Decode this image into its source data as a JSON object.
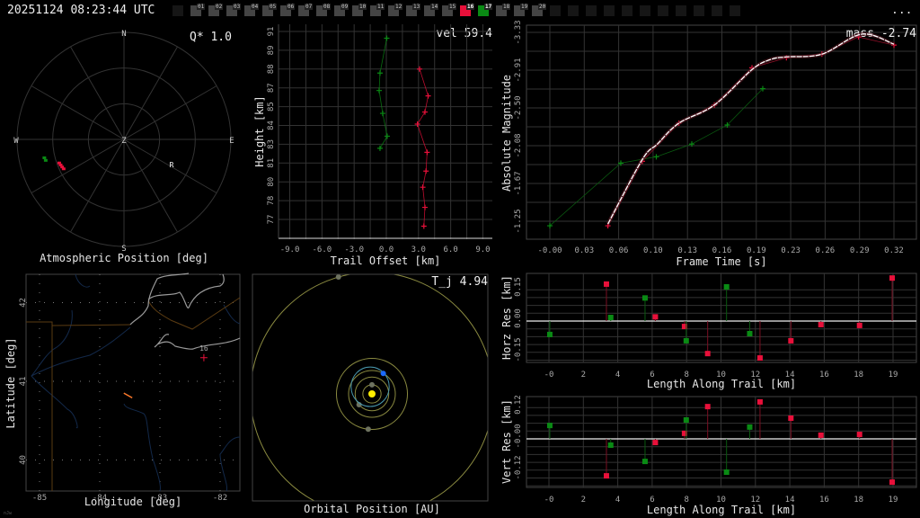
{
  "header": {
    "timestamp": "20251124 08:23:44 UTC",
    "menu_label": "...",
    "frames": [
      "01",
      "02",
      "03",
      "04",
      "05",
      "06",
      "07",
      "08",
      "09",
      "10",
      "11",
      "12",
      "13",
      "14",
      "15",
      "16",
      "17",
      "18",
      "19",
      "20"
    ],
    "selected_red": "16",
    "selected_green": "17",
    "blank_before": 1,
    "blank_after": 11
  },
  "colors": {
    "station_a": "#e8103a",
    "station_b": "#0a8a14",
    "fit": "#ffffff",
    "grid": "#333333",
    "background": "#000000"
  },
  "chart_data": [
    {
      "id": "atmospheric",
      "type": "scatter",
      "title": "Atmospheric Position [deg]",
      "annotation": "Q*  1.0",
      "compass": {
        "n": "N",
        "s": "S",
        "e": "E",
        "w": "W",
        "zenith": "Z"
      },
      "rings_alt_deg": [
        60,
        30,
        0
      ],
      "series": [
        {
          "name": "station-16",
          "color": "#e8103a",
          "points": [
            {
              "az": 244,
              "alt": 33.5
            },
            {
              "az": 246,
              "alt": 33
            },
            {
              "az": 248,
              "alt": 32.5
            },
            {
              "az": 250,
              "alt": 32
            }
          ]
        },
        {
          "name": "station-17",
          "color": "#0a8a14",
          "points": [
            {
              "az": 255,
              "alt": 21.8
            },
            {
              "az": 257,
              "alt": 21.2
            }
          ]
        }
      ],
      "radiant": {
        "label": "R",
        "az": 118,
        "alt": 44.6
      }
    },
    {
      "id": "trail",
      "type": "line",
      "xlabel": "Trail Offset [km]",
      "ylabel": "Height [km]",
      "annotation": "vel 59.4",
      "xticks": [
        "-9.0",
        "-6.0",
        "-3.0",
        "0.0",
        "3.0",
        "6.0",
        "9.0"
      ],
      "yticks": [
        "91",
        "89",
        "88",
        "87",
        "85",
        "84",
        "83",
        "81",
        "80",
        "78",
        "77"
      ],
      "xlim": [
        -9.9,
        10.0
      ],
      "ylim": [
        76.0,
        91.5
      ],
      "series": [
        {
          "name": "station-17",
          "color": "#0a8a14",
          "x": [
            0.04,
            -0.59,
            -0.67,
            -0.34,
            0.08,
            -0.59
          ],
          "y": [
            90.5,
            87.9,
            86.6,
            84.9,
            83.2,
            82.3
          ]
        },
        {
          "name": "station-16",
          "color": "#e8103a",
          "x": [
            3.1,
            3.9,
            3.6,
            2.9,
            3.8,
            3.7,
            3.4,
            3.6,
            3.5
          ],
          "y": [
            88.2,
            86.2,
            85.0,
            84.1,
            82.0,
            80.6,
            79.4,
            77.9,
            76.5
          ]
        }
      ]
    },
    {
      "id": "magnitude",
      "type": "line",
      "xlabel": "Frame Time [s]",
      "ylabel": "Absolute Magnitude",
      "annotation": "mass -2.74",
      "xticks": [
        "-0.00",
        "0.03",
        "0.06",
        "0.10",
        "0.13",
        "0.16",
        "0.19",
        "0.23",
        "0.26",
        "0.29",
        "0.32"
      ],
      "yticks": [
        "-3.33",
        "-2.91",
        "-2.50",
        "-2.08",
        "-1.67",
        "-1.25"
      ],
      "series": [
        {
          "name": "station-17",
          "color": "#0a8a14",
          "x": [
            0.0,
            0.066,
            0.099,
            0.132,
            0.165,
            0.198
          ],
          "y": [
            -1.2,
            -1.89,
            -1.96,
            -2.1,
            -2.31,
            -2.71
          ]
        },
        {
          "name": "station-16",
          "color": "#e8103a",
          "x": [
            0.054,
            0.086,
            0.12,
            0.153,
            0.188,
            0.22,
            0.253,
            0.287,
            0.32
          ],
          "y": [
            -1.2,
            -1.91,
            -2.33,
            -2.53,
            -2.94,
            -3.05,
            -3.09,
            -3.28,
            -3.19
          ]
        },
        {
          "name": "fit",
          "color": "#ffffff",
          "x": [
            0.054,
            0.086,
            0.1,
            0.12,
            0.153,
            0.188,
            0.205,
            0.22,
            0.253,
            0.29,
            0.32
          ],
          "y": [
            -1.22,
            -1.93,
            -2.1,
            -2.33,
            -2.53,
            -2.92,
            -3.03,
            -3.06,
            -3.09,
            -3.31,
            -3.2
          ]
        }
      ]
    },
    {
      "id": "horz-res",
      "type": "scatter",
      "xlabel": "Length Along Trail [km]",
      "ylabel": "Horz Res [km]",
      "xticks": [
        "-0",
        "2",
        "4",
        "6",
        "8",
        "10",
        "12",
        "14",
        "16",
        "18",
        "19"
      ],
      "yticks": [
        "0.15",
        "0.00",
        "-0.15"
      ],
      "series": [
        {
          "name": "station-16",
          "color": "#e8103a",
          "x": [
            3.35,
            6.2,
            7.9,
            9.25,
            12.3,
            14.1,
            15.85,
            18.1,
            20.0
          ],
          "y": [
            0.176,
            0.02,
            -0.026,
            -0.155,
            -0.176,
            -0.094,
            -0.017,
            -0.021,
            0.205
          ]
        },
        {
          "name": "station-17",
          "color": "#0a8a14",
          "x": [
            0.05,
            3.6,
            5.6,
            8.0,
            10.35,
            11.7
          ],
          "y": [
            -0.064,
            0.017,
            0.11,
            -0.094,
            0.163,
            -0.06
          ]
        }
      ]
    },
    {
      "id": "vert-res",
      "type": "scatter",
      "xlabel": "Length Along Trail [km]",
      "ylabel": "Vert Res [km]",
      "xticks": [
        "-0",
        "2",
        "4",
        "6",
        "8",
        "10",
        "12",
        "14",
        "16",
        "18",
        "19"
      ],
      "yticks": [
        "0.12",
        "-0.00",
        "-0.12"
      ],
      "series": [
        {
          "name": "station-16",
          "color": "#e8103a",
          "x": [
            3.35,
            6.2,
            7.9,
            9.25,
            12.3,
            14.1,
            15.85,
            18.1,
            20.0
          ],
          "y": [
            -0.141,
            -0.014,
            0.021,
            0.123,
            0.141,
            0.079,
            0.014,
            0.017,
            -0.165
          ]
        },
        {
          "name": "station-17",
          "color": "#0a8a14",
          "x": [
            0.05,
            3.6,
            5.6,
            8.0,
            10.35,
            11.7
          ],
          "y": [
            0.051,
            -0.024,
            -0.086,
            0.072,
            -0.127,
            0.045
          ]
        }
      ]
    },
    {
      "id": "map",
      "type": "scatter",
      "xlabel": "Longitude [deg]",
      "ylabel": "Latitude [deg]",
      "xticks": [
        "-85",
        "-84",
        "-83",
        "-82"
      ],
      "yticks": [
        "42",
        "41",
        "40"
      ],
      "station": {
        "label": "16",
        "lon": -82.27,
        "lat": 41.3
      },
      "track": {
        "lon": [
          -83.6,
          -83.46
        ],
        "lat": [
          40.85,
          40.79
        ]
      },
      "credit": "nJw"
    },
    {
      "id": "orbit",
      "type": "scatter",
      "xlabel": "Orbital Position [AU]",
      "annotation": "T_j 4.94",
      "planets": [
        {
          "name": "mercury",
          "a": 0.39,
          "angle": 90
        },
        {
          "name": "venus",
          "a": 0.72,
          "angle": 220
        },
        {
          "name": "earth",
          "a": 1.0,
          "angle": 61
        },
        {
          "name": "mars",
          "a": 1.52,
          "angle": 264
        },
        {
          "name": "jupiter",
          "a": 5.2,
          "angle": 106
        }
      ],
      "meteoroid_orbit": {
        "a": 0.87,
        "e": 0.35
      }
    }
  ]
}
